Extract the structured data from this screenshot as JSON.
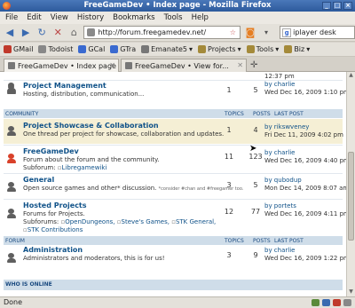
{
  "window": {
    "title": "FreeGameDev • Index page - Mozilla Firefox"
  },
  "menu": [
    "File",
    "Edit",
    "View",
    "History",
    "Bookmarks",
    "Tools",
    "Help"
  ],
  "nav": {
    "url": "http://forum.freegamedev.net/",
    "search": "iplayer desk"
  },
  "bookmarks": [
    {
      "label": "GMail",
      "color": "#c0392b"
    },
    {
      "label": "Todoist",
      "color": "#888888"
    },
    {
      "label": "GCal",
      "color": "#3a6ad0"
    },
    {
      "label": "GTra",
      "color": "#3a6ad0"
    },
    {
      "label": "Emanate5",
      "color": "#777777"
    },
    {
      "label": "Projects",
      "color": "#a48a3a"
    },
    {
      "label": "Tools",
      "color": "#a48a3a"
    },
    {
      "label": "Biz",
      "color": "#a48a3a"
    }
  ],
  "tabs": [
    {
      "label": "FreeGameDev • Index page"
    },
    {
      "label": "FreeGameDev • View for..."
    }
  ],
  "top_partial": {
    "lastpost_time": "12:37 pm"
  },
  "project_management": {
    "title": "Project Management",
    "desc": "Hosting, distribution, communication...",
    "topics": "1",
    "posts": "5",
    "lp_by": "by charlie",
    "lp_time": "Wed Dec 16, 2009 1:10 pm"
  },
  "community_header": {
    "name": "COMMUNITY",
    "topics": "Topics",
    "posts": "Posts",
    "lastpost": "Last post"
  },
  "project_showcase": {
    "title": "Project Showcase & Collaboration",
    "desc": "One thread per project for showcase, collaboration and updates.",
    "topics": "1",
    "posts": "4",
    "lp_by": "by rikswveney",
    "lp_time": "Fri Dec 11, 2009 4:02 pm"
  },
  "freegamedev_forum": {
    "title": "FreeGameDev",
    "desc": "Forum about the forum and the community.",
    "sub_label": "Subforum:",
    "sub": "Libregamewiki",
    "topics": "11",
    "posts": "123",
    "lp_by": "by charlie",
    "lp_time": "Wed Dec 16, 2009 4:40 pm"
  },
  "general": {
    "title": "General",
    "desc": "Open source games and other* discussion.",
    "note": "*consider #chan and #freegamer too.",
    "topics": "3",
    "posts": "5",
    "lp_by": "by qubodup",
    "lp_time": "Mon Dec 14, 2009 8:07 am"
  },
  "hosted_projects": {
    "title": "Hosted Projects",
    "desc": "Forums for Projects.",
    "sub_label": "Subforums:",
    "subs": [
      "OpenDungeons,",
      "Steve's Games,",
      "STK General,",
      "STK Contributions"
    ],
    "topics": "12",
    "posts": "77",
    "lp_by": "by portets",
    "lp_time": "Wed Dec 16, 2009 4:11 pm"
  },
  "forum_header": {
    "name": "FORUM",
    "topics": "Topics",
    "posts": "Posts",
    "lastpost": "Last post"
  },
  "administration": {
    "title": "Administration",
    "desc": "Administrators and moderators, this is for us!",
    "topics": "3",
    "posts": "9",
    "lp_by": "by charlie",
    "lp_time": "Wed Dec 16, 2009 1:22 pm"
  },
  "who_online": {
    "label": "WHO IS ONLINE"
  },
  "status": {
    "text": "Done"
  }
}
